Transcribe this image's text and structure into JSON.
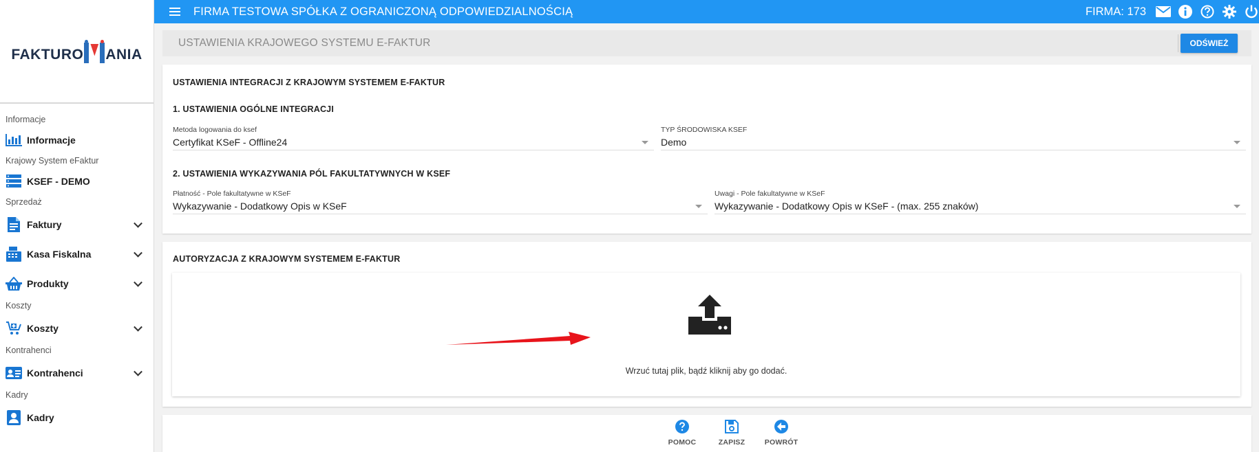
{
  "app": {
    "company_name": "FIRMA TESTOWA SPÓŁKA Z OGRANICZONĄ ODPOWIEDZIALNOŚCIĄ",
    "firma_label": "FIRMA: 173",
    "logo_left": "FAKTURO",
    "logo_right": "ANIA"
  },
  "sidebar": {
    "sections": {
      "s1": "Informacje",
      "s2": "Krajowy System eFaktur",
      "s3": "Sprzedaż",
      "s4": "Koszty",
      "s5": "Kontrahenci",
      "s6": "Kadry"
    },
    "items": {
      "informacje": "Informacje",
      "ksef": "KSEF - DEMO",
      "faktury": "Faktury",
      "kasa": "Kasa Fiskalna",
      "produkty": "Produkty",
      "koszty": "Koszty",
      "kontrahenci": "Kontrahenci",
      "kadry": "Kadry"
    }
  },
  "header": {
    "title": "USTAWIENIA KRAJOWEGO SYSTEMU E-FAKTUR",
    "refresh_label": "ODŚWIEŻ"
  },
  "integration": {
    "title": "USTAWIENIA INTEGRACJI Z KRAJOWYM SYSTEMEM E-FAKTUR",
    "section1": "1. USTAWIENIA OGÓLNE INTEGRACJI",
    "login_method_label": "Metoda logowania do ksef",
    "login_method_value": "Certyfikat KSeF - Offline24",
    "env_type_label": "TYP ŚRODOWISKA KSEF",
    "env_type_value": "Demo",
    "section2": "2. USTAWIENIA WYKAZYWANIA PÓL FAKULTATYWNYCH W KSEF",
    "payment_label": "Płatność - Pole fakultatywne w KSeF",
    "payment_value": "Wykazywanie - Dodatkowy Opis w KSeF",
    "notes_label": "Uwagi - Pole fakultatywne w KSeF",
    "notes_value": "Wykazywanie - Dodatkowy Opis w KSeF - (max. 255 znaków)"
  },
  "authorization": {
    "title": "AUTORYZACJA Z KRAJOWYM SYSTEMEM E-FAKTUR",
    "dropzone_text": "Wrzuć tutaj plik, bądź kliknij aby go dodać."
  },
  "footer": {
    "help": "POMOC",
    "save": "ZAPISZ",
    "back": "POWRÓT"
  },
  "colors": {
    "primary": "#2196f3",
    "button": "#1e88e5",
    "arrow": "#e8141b"
  }
}
